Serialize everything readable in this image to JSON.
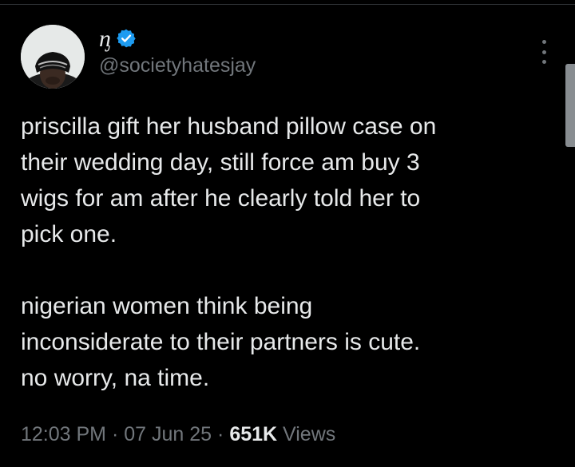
{
  "author": {
    "display_name": "ᶇ",
    "handle": "@societyhatesjay",
    "verified_badge_icon": "verified-badge-icon",
    "verified_color": "#1d9bf0"
  },
  "tweet": {
    "text": "priscilla gift her husband pillow case on\ntheir wedding day, still force am buy 3\nwigs for am after he clearly told her to\npick one.\n\nnigerian women think being\ninconsiderate to their partners is cute.\nno worry, na time."
  },
  "meta": {
    "time": "12:03 PM",
    "separator": "·",
    "date": "07 Jun 25",
    "views_count": "651K",
    "views_label": "Views"
  },
  "icons": {
    "more": "more-options-icon"
  },
  "colors": {
    "background": "#000000",
    "primary_text": "#e7e9ea",
    "secondary_text": "#71767b",
    "accent": "#1d9bf0"
  }
}
